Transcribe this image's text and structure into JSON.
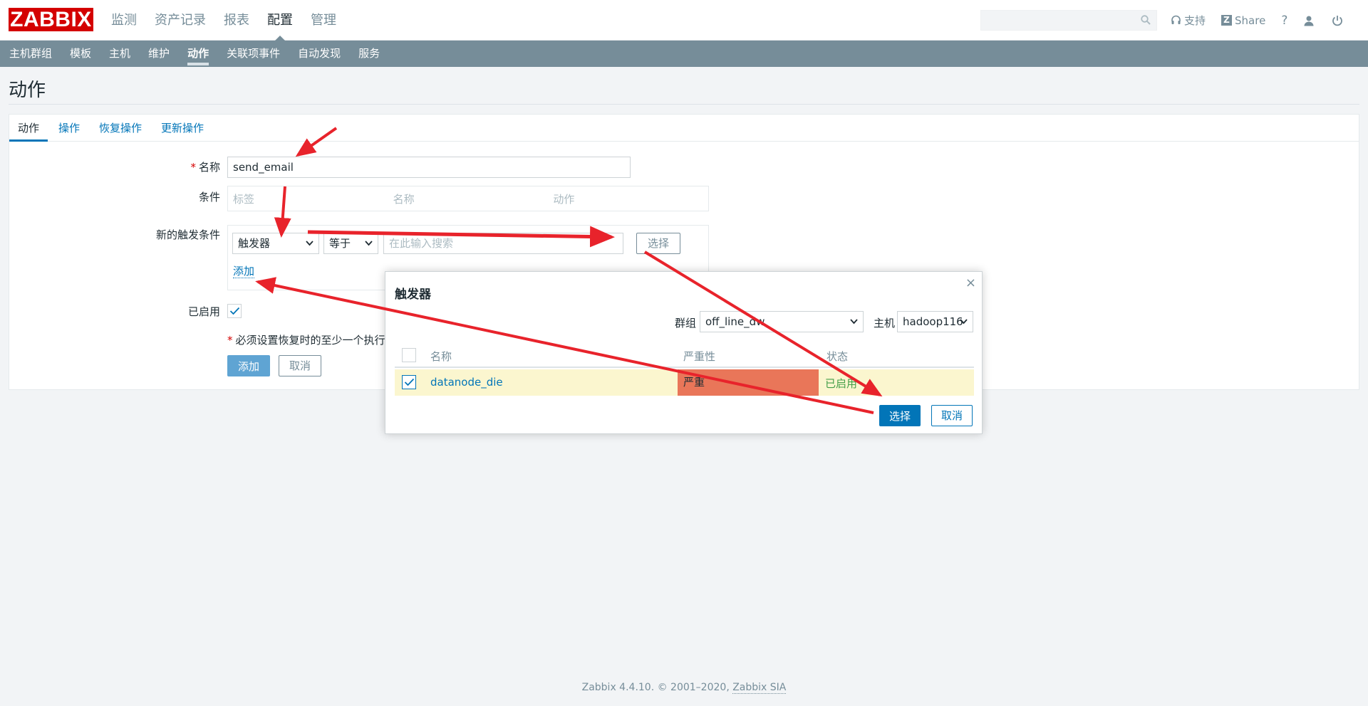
{
  "header": {
    "logo": "ZABBIX",
    "menu": [
      {
        "label": "监测"
      },
      {
        "label": "资产记录"
      },
      {
        "label": "报表"
      },
      {
        "label": "配置"
      },
      {
        "label": "管理"
      }
    ],
    "active_menu": "配置",
    "search": {
      "value": "",
      "placeholder": ""
    },
    "support_label": "支持",
    "share_label": "Share",
    "share_glyph": "Z",
    "help_glyph": "?"
  },
  "subnav": {
    "items": [
      {
        "label": "主机群组"
      },
      {
        "label": "模板"
      },
      {
        "label": "主机"
      },
      {
        "label": "维护"
      },
      {
        "label": "动作"
      },
      {
        "label": "关联项事件"
      },
      {
        "label": "自动发现"
      },
      {
        "label": "服务"
      }
    ],
    "active": "动作"
  },
  "page_title": "动作",
  "tabs": [
    {
      "label": "动作"
    },
    {
      "label": "操作"
    },
    {
      "label": "恢复操作"
    },
    {
      "label": "更新操作"
    }
  ],
  "form": {
    "name_label": "名称",
    "name_value": "send_email",
    "required_mark": "*",
    "conditions_label": "条件",
    "conditions_columns": [
      "标签",
      "名称",
      "动作"
    ],
    "new_condition_label": "新的触发条件",
    "condition_type": "触发器",
    "operator": "等于",
    "search_placeholder": "在此输入搜索",
    "select_button": "选择",
    "add_link": "添加",
    "enabled_label": "已启用",
    "enabled": true,
    "note": "必须设置恢复时的至少一个执行",
    "add_button": "添加",
    "cancel_button": "取消"
  },
  "modal": {
    "title": "触发器",
    "close_glyph": "×",
    "group_label": "群组",
    "group_value": "off_line_dw",
    "host_label": "主机",
    "host_value": "hadoop116",
    "columns": {
      "name": "名称",
      "severity": "严重性",
      "status": "状态"
    },
    "rows": [
      {
        "name": "datanode_die",
        "severity": "严重",
        "status": "已启用",
        "checked": true
      }
    ],
    "select_button": "选择",
    "cancel_button": "取消"
  },
  "footer": {
    "text": "Zabbix 4.4.10. © 2001–2020,",
    "link": "Zabbix SIA"
  },
  "colors": {
    "brand": "#d40000",
    "subnav": "#768d99",
    "link": "#0275b8",
    "severity_high": "#e97659",
    "row_highlight": "#fbf6cf",
    "annotation": "#e8232b"
  }
}
